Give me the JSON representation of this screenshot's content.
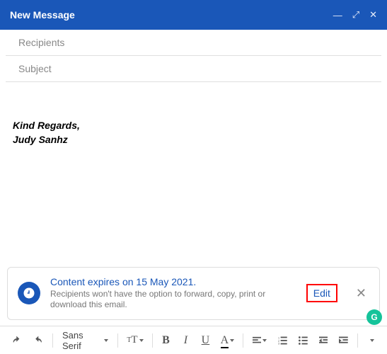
{
  "header": {
    "title": "New Message"
  },
  "fields": {
    "recipients_placeholder": "Recipients",
    "subject_placeholder": "Subject"
  },
  "body": {
    "signature_line1": "Kind Regards,",
    "signature_line2": "Judy Sanhz"
  },
  "confidential": {
    "title": "Content expires on 15 May 2021.",
    "description": "Recipients won't have the option to forward, copy, print or download this email.",
    "edit_label": "Edit"
  },
  "toolbar": {
    "font": "Sans Serif",
    "bold": "B",
    "italic": "I",
    "underline": "U",
    "color": "A"
  },
  "grammarly": {
    "label": "G"
  }
}
